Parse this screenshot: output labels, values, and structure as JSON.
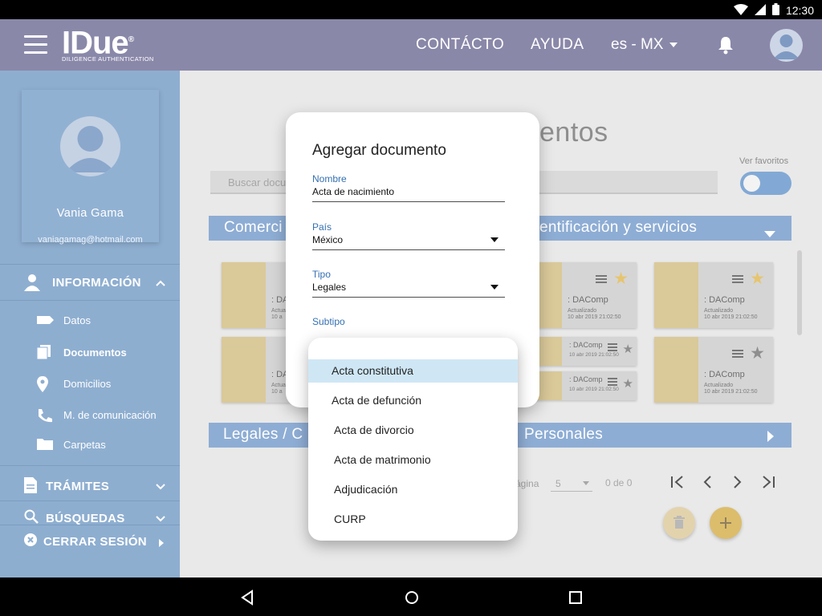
{
  "status_bar": {
    "time": "12:30"
  },
  "appbar": {
    "logo": "IDue",
    "logo_reg": "®",
    "logo_tagline": "DILIGENCE AUTHENTICATION",
    "nav": [
      "CONTÁCTO",
      "AYUDA"
    ],
    "language": "es - MX"
  },
  "sidebar": {
    "user_name": "Vania Gama",
    "user_email": "vaniagamag@hotmail.com",
    "sections": {
      "informacion": "INFORMACIÓN",
      "tramites": "TRÁMITES",
      "busquedas": "BÚSQUEDAS",
      "cerrar": "CERRAR SESIÓN"
    },
    "items": [
      "Datos",
      "Documentos",
      "Domicilios",
      "M. de comunicación",
      "Carpetas"
    ]
  },
  "main": {
    "title": "entos",
    "search_placeholder": "Buscar docu",
    "favorites_label": "Ver favoritos",
    "category1_left": "Comerci",
    "category1_right": "entificación y servicios",
    "category2_left": "Legales / C",
    "category2_right": "Personales",
    "doc_title": ": DAComp",
    "doc_partial_title": ": DA",
    "doc_updated": "Actualizado",
    "doc_updated_partial": "Actua",
    "doc_date": "10 abr 2019 21:02:50",
    "doc_date_partial": "10 a",
    "pager": {
      "label": "ágina",
      "size": "5",
      "count": "0 de 0"
    }
  },
  "dialog": {
    "title": "Agregar documento",
    "fields": {
      "nombre": {
        "label": "Nombre",
        "value": "Acta de nacimiento"
      },
      "pais": {
        "label": "País",
        "value": "México"
      },
      "tipo": {
        "label": "Tipo",
        "value": "Legales"
      },
      "subtipo": {
        "label": "Subtipo",
        "value": ""
      }
    }
  },
  "dropdown": {
    "options": [
      "Acta constitutiva",
      "Acta de defunción",
      "Acta de divorcio",
      "Acta de matrimonio",
      "Adjudicación",
      "CURP"
    ],
    "selected": "Acta constitutiva"
  },
  "colors": {
    "appbar": "#8a88a9",
    "sidebar": "#8eaed0",
    "category_bar": "#8eadd4",
    "label_blue": "#3470b3",
    "star_gold": "#e6c56f",
    "selected_option": "#cfe7f5"
  }
}
